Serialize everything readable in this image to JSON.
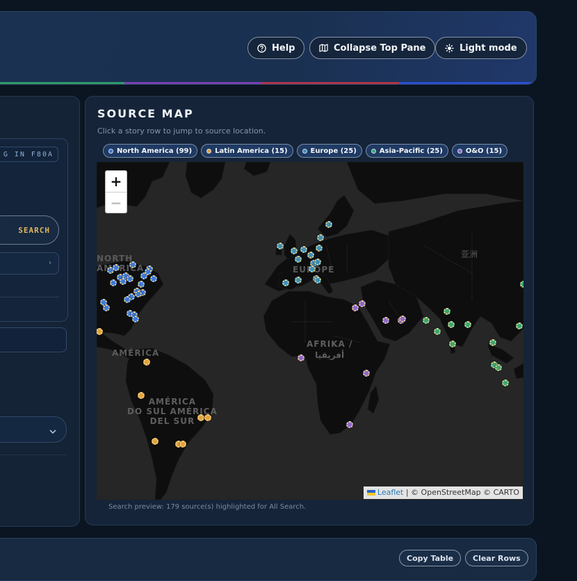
{
  "header": {
    "buttons": [
      {
        "label": "Help",
        "icon": "help-circle-icon"
      },
      {
        "label": "Collapse Top Pane",
        "icon": "map-icon"
      },
      {
        "label": "Light mode",
        "icon": "sun-icon"
      }
    ],
    "stripe_colors": [
      "#2f9a6a",
      "#7a3fb0",
      "#b0344a",
      "#2a4fd0"
    ]
  },
  "left_panel": {
    "tag_text": "G IN F80A",
    "search_label": "SEARCH"
  },
  "source_map": {
    "title": "SOURCE MAP",
    "subtitle": "Click a story row to jump to source location.",
    "chips": [
      {
        "label": "North America (99)",
        "color": "#3b79d9"
      },
      {
        "label": "Latin America (15)",
        "color": "#e2a33d"
      },
      {
        "label": "Europe (25)",
        "color": "#3d8fb6"
      },
      {
        "label": "Asia-Pacific (25)",
        "color": "#3aa574"
      },
      {
        "label": "O&O (15)",
        "color": "#8b68c9"
      }
    ],
    "zoom_in": "+",
    "zoom_out": "−",
    "attribution_link": "Leaflet",
    "attribution_text": " | © OpenStreetMap © CARTO",
    "labels": {
      "north_america": "NORTH\nAMERICA",
      "europe": "EUROPE",
      "asia": "亚洲",
      "africa": "AFRIKA /\nأفريقيا",
      "america": "AMÉRICA",
      "south_america": "AMÉRICA\nDO SUL AMÉRICA\nDEL SUR"
    },
    "footer": "Search preview: 179 source(s) highlighted for All Search."
  },
  "bottom_pane": {
    "buttons": [
      "Copy Table",
      "Clear Rows"
    ]
  }
}
